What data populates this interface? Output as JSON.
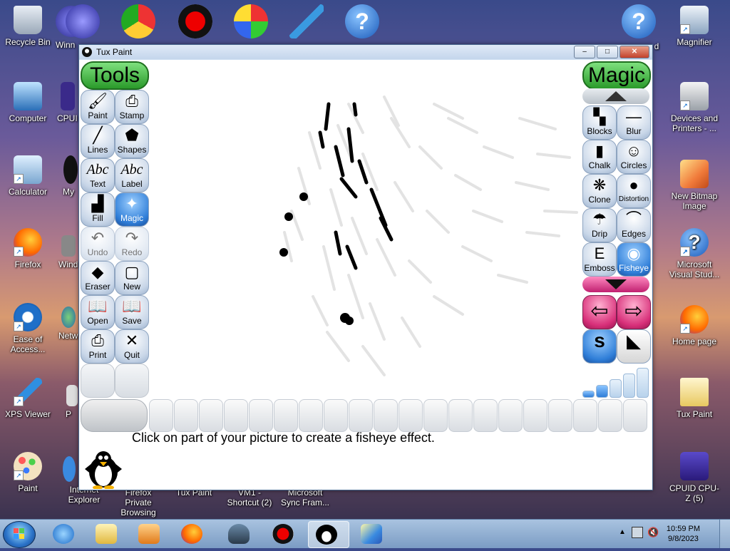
{
  "desktop": {
    "top_row": [
      "Recycle Bin",
      "Winn..."
    ],
    "left_col": [
      {
        "label": "Recycle Bin"
      },
      {
        "label": "Computer"
      },
      {
        "label": "Calculator"
      },
      {
        "label": "Firefox"
      },
      {
        "label": "Ease of Access..."
      },
      {
        "label": "XPS Viewer"
      },
      {
        "label": "Paint"
      }
    ],
    "second_col_partial": [
      "Winn",
      "CPUI",
      "My",
      "Wind",
      "Netw",
      "P",
      "Internet Explorer"
    ],
    "bottom_row": [
      "Firefox Private Browsing",
      "Tux Paint",
      "VM1 - Shortcut (2)",
      "Microsoft Sync Fram..."
    ],
    "right_col": [
      {
        "label": "Magnifier"
      },
      {
        "label": "Devices and Printers - ..."
      },
      {
        "label": "New Bitmap Image"
      },
      {
        "label": "Microsoft Visual Stud..."
      },
      {
        "label": "Home page"
      },
      {
        "label": "Tux Paint"
      },
      {
        "label": "CPUID CPU-Z (5)"
      }
    ],
    "right_partial": [
      "d",
      "...",
      "U-Z",
      "er"
    ]
  },
  "window": {
    "title": "Tux Paint",
    "buttons": {
      "minimize": "–",
      "maximize": "□",
      "close": "✕"
    }
  },
  "tools": {
    "title": "Tools",
    "items": [
      {
        "label": "Paint",
        "symbol": "🖌"
      },
      {
        "label": "Stamp",
        "symbol": "⎙"
      },
      {
        "label": "Lines",
        "symbol": "╱"
      },
      {
        "label": "Shapes",
        "symbol": "⬟"
      },
      {
        "label": "Text",
        "symbol": "Abc"
      },
      {
        "label": "Label",
        "symbol": "Abc"
      },
      {
        "label": "Fill",
        "symbol": "▟"
      },
      {
        "label": "Magic",
        "symbol": "✦"
      },
      {
        "label": "Undo",
        "symbol": "↶"
      },
      {
        "label": "Redo",
        "symbol": "↷"
      },
      {
        "label": "Eraser",
        "symbol": "◆"
      },
      {
        "label": "New",
        "symbol": "▢"
      },
      {
        "label": "Open",
        "symbol": "📖"
      },
      {
        "label": "Save",
        "symbol": "📖"
      },
      {
        "label": "Print",
        "symbol": "⎙"
      },
      {
        "label": "Quit",
        "symbol": "✕"
      }
    ]
  },
  "magic": {
    "title": "Magic",
    "items": [
      {
        "label": "Blocks",
        "symbol": "▚"
      },
      {
        "label": "Blur",
        "symbol": "—"
      },
      {
        "label": "Chalk",
        "symbol": "▮"
      },
      {
        "label": "Circles",
        "symbol": "☺"
      },
      {
        "label": "Clone",
        "symbol": "❋"
      },
      {
        "label": "Distortion",
        "symbol": "●"
      },
      {
        "label": "Drip",
        "symbol": "☂"
      },
      {
        "label": "Edges",
        "symbol": "⌒"
      },
      {
        "label": "Emboss",
        "symbol": "E"
      },
      {
        "label": "Fisheye",
        "symbol": "◉"
      }
    ],
    "nav": {
      "prev": "⇦",
      "next": "⇨"
    },
    "modes": [
      "s",
      "◣"
    ]
  },
  "instruction": "Click on part of your picture to create a fisheye effect.",
  "taskbar": {
    "time": "10:59 PM",
    "date": "9/8/2023"
  },
  "colors": {
    "selected_tool": "#2f7ed8",
    "title_green": "#2a9a2a",
    "nav_pink": "#d8307a"
  }
}
